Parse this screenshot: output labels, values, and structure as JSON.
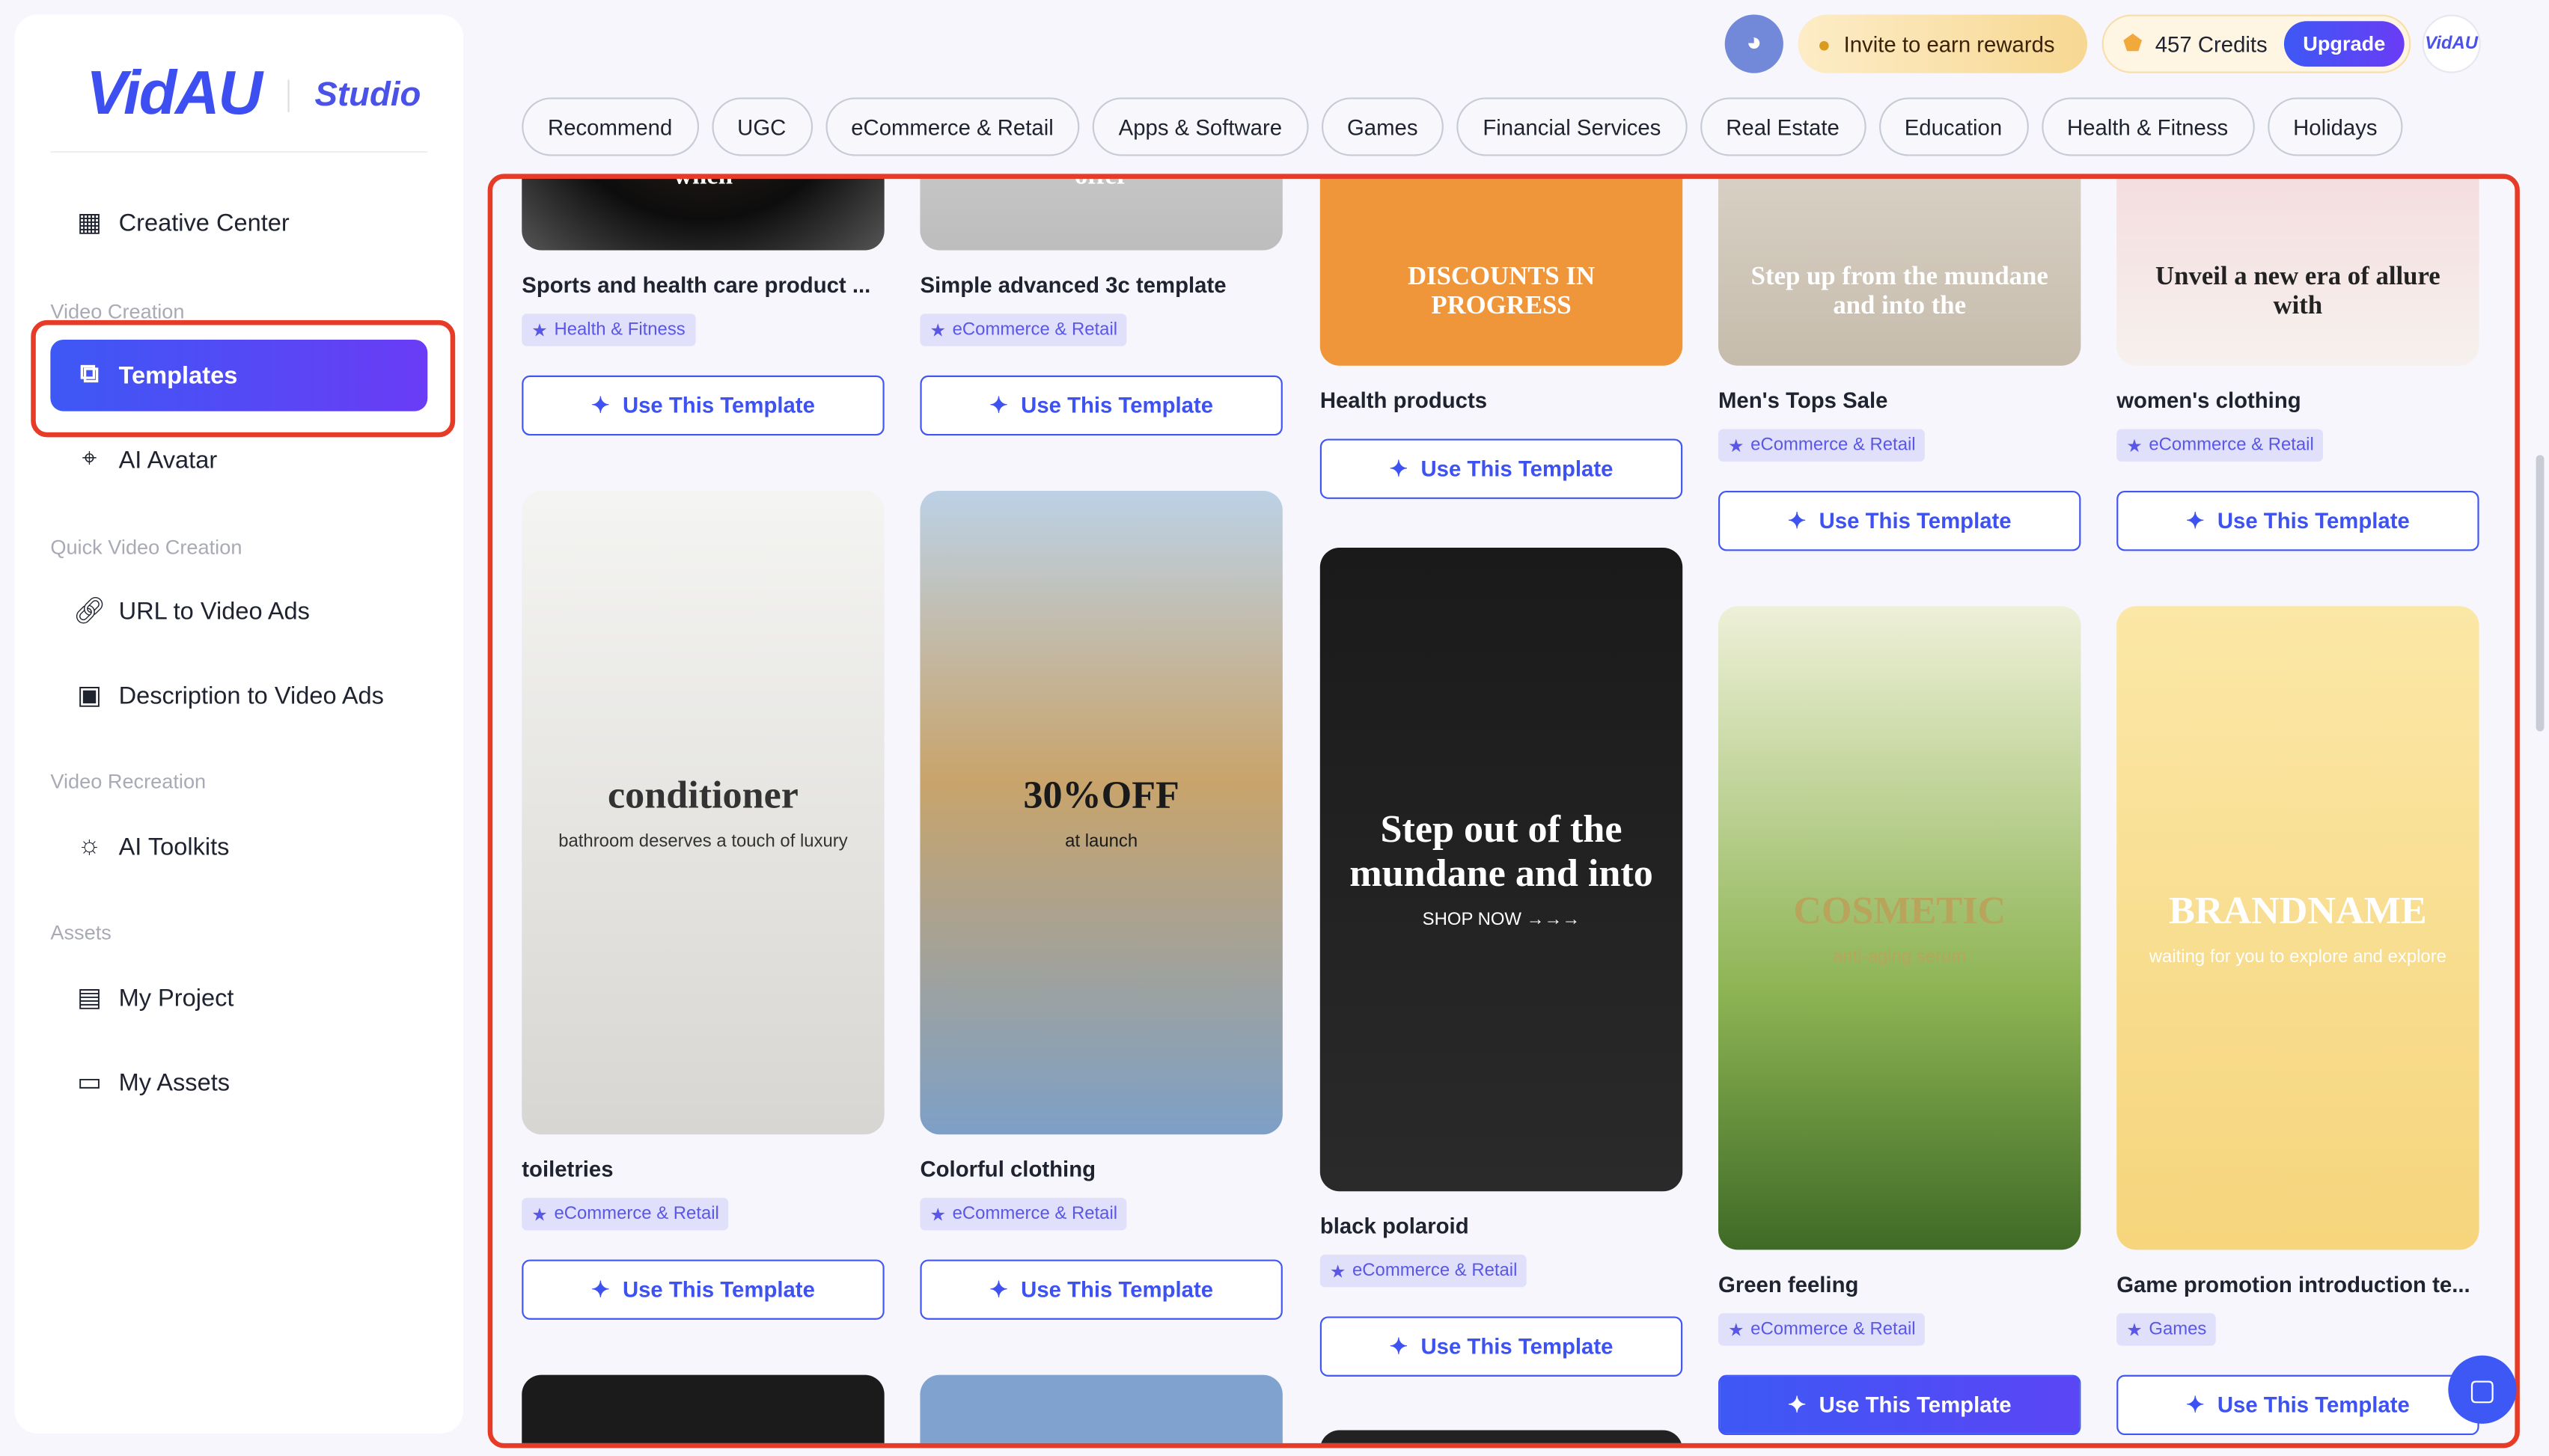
{
  "brand": {
    "logo": "VidAU",
    "product": "Studio"
  },
  "sidebar": {
    "creative_center": "Creative Center",
    "sections": [
      "Video Creation",
      "Quick Video Creation",
      "Video Recreation",
      "Assets"
    ],
    "items": [
      {
        "label": "Templates",
        "icon": "templates-icon",
        "active": true
      },
      {
        "label": "AI Avatar",
        "icon": "avatar-scan-icon"
      },
      {
        "label": "URL to Video Ads",
        "icon": "link-icon"
      },
      {
        "label": "Description to Video Ads",
        "icon": "description-icon"
      },
      {
        "label": "AI Toolkits",
        "icon": "bulb-icon"
      },
      {
        "label": "My Project",
        "icon": "project-icon"
      },
      {
        "label": "My Assets",
        "icon": "folder-icon"
      }
    ]
  },
  "header": {
    "invite": "Invite to earn rewards",
    "credits": "457 Credits",
    "upgrade": "Upgrade",
    "avatar": "VidAU"
  },
  "categories": [
    "Recommend",
    "UGC",
    "eCommerce & Retail",
    "Apps & Software",
    "Games",
    "Financial Services",
    "Real Estate",
    "Education",
    "Health & Fitness",
    "Holidays"
  ],
  "button_label": "Use This Template",
  "colors": {
    "accent": "#3d52f0",
    "highlight": "#e63b27",
    "tag_bg": "#e1e0fb"
  },
  "columns": [
    [
      {
        "title": "Sports and health care product ...",
        "tag": "Health & Fitness",
        "thumb_text": "when"
      },
      {
        "title": "toiletries",
        "tag": "eCommerce & Retail",
        "thumb_text": "conditioner",
        "thumb_sub": "bathroom deserves a touch of luxury"
      },
      {
        "title": "",
        "tag": "",
        "thumb_text": ""
      }
    ],
    [
      {
        "title": "Simple advanced 3c template",
        "tag": "eCommerce & Retail",
        "thumb_text": "offer"
      },
      {
        "title": "Colorful clothing",
        "tag": "eCommerce & Retail",
        "thumb_text": "30%OFF",
        "thumb_sub": "at launch"
      },
      {
        "title": "",
        "tag": "",
        "thumb_text": ""
      }
    ],
    [
      {
        "title": "Health products",
        "tag": "",
        "thumb_text": "DISCOUNTS IN PROGRESS"
      },
      {
        "title": "black polaroid",
        "tag": "eCommerce & Retail",
        "thumb_text": "Step out of the mundane and into",
        "thumb_sub": "SHOP NOW →→→"
      },
      {
        "title": "",
        "tag": "",
        "thumb_text": ""
      }
    ],
    [
      {
        "title": "Men's Tops Sale",
        "tag": "eCommerce & Retail",
        "thumb_text": "Step up from the mundane and into the"
      },
      {
        "title": "Green feeling",
        "tag": "eCommerce & Retail",
        "thumb_text": "COSMETIC",
        "thumb_sub": "anti-aging serum",
        "filled": true
      }
    ],
    [
      {
        "title": "women's clothing",
        "tag": "eCommerce & Retail",
        "thumb_text": "Unveil a new era of allure with"
      },
      {
        "title": "Game promotion introduction te...",
        "tag": "Games",
        "thumb_text": "BRANDNAME",
        "thumb_sub": "waiting for you to explore and explore"
      }
    ]
  ]
}
